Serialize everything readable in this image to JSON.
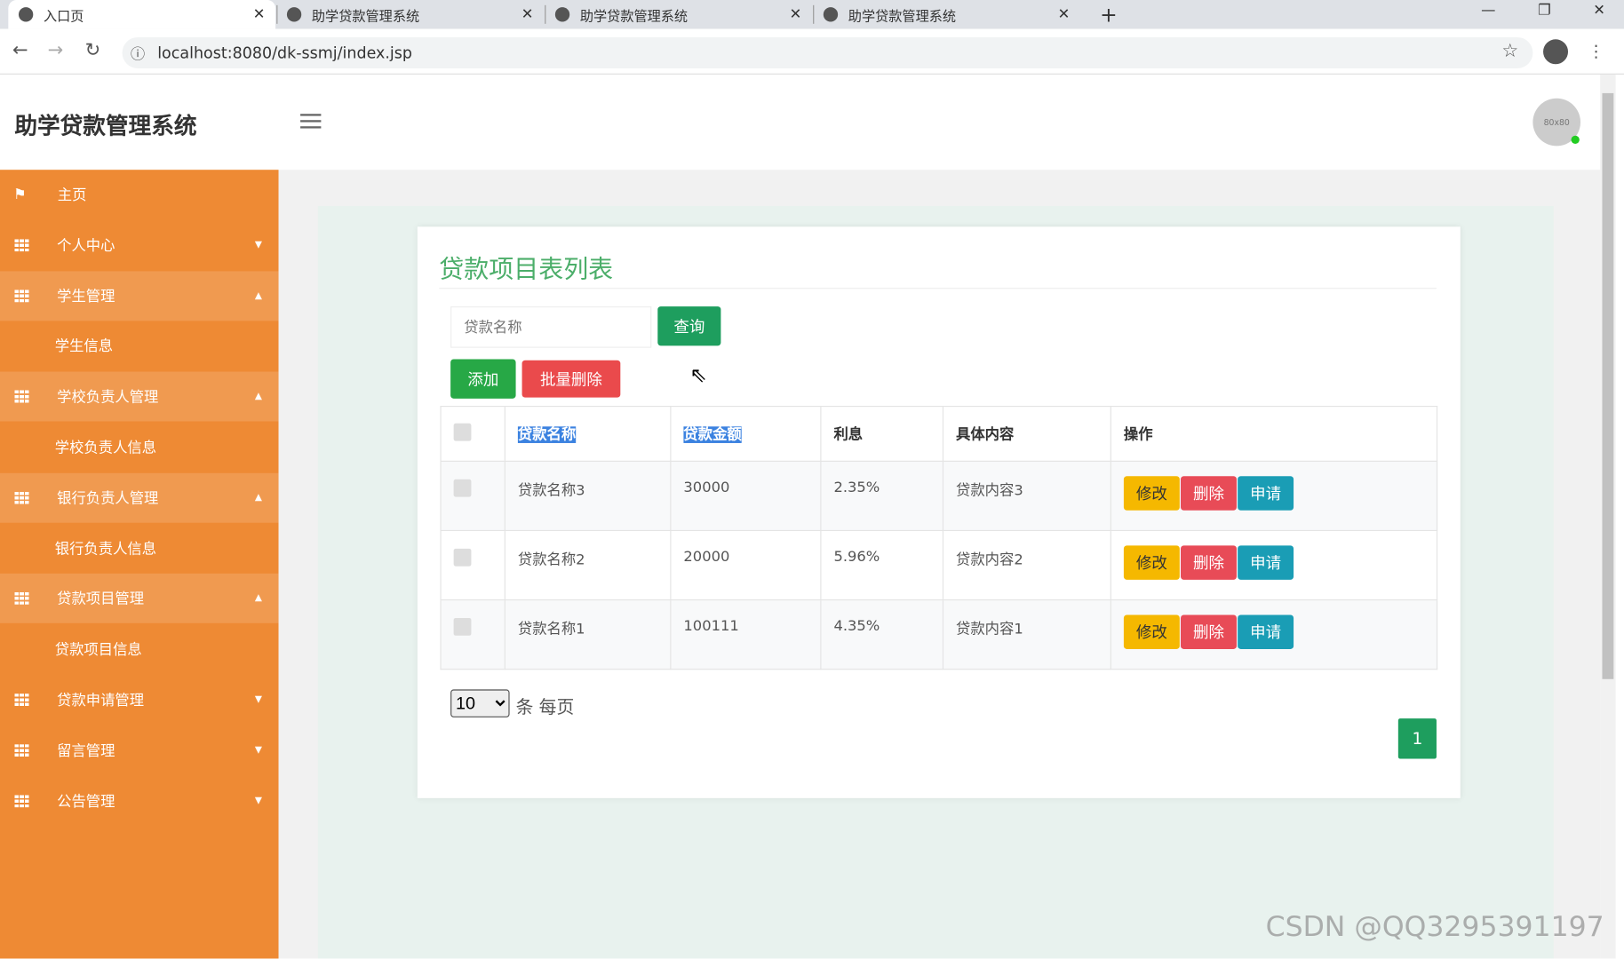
{
  "browser": {
    "tabs": [
      {
        "title": "入口页",
        "active": true
      },
      {
        "title": "助学贷款管理系统"
      },
      {
        "title": "助学贷款管理系统"
      },
      {
        "title": "助学贷款管理系统"
      }
    ],
    "new_tab": "+",
    "url": "localhost:8080/dk-ssmj/index.jsp"
  },
  "header": {
    "title": "助学贷款管理系统",
    "avatar_text": "80x80"
  },
  "sidebar": {
    "items": [
      {
        "label": "主页",
        "icon": "flag-icon"
      },
      {
        "label": "个人中心",
        "icon": "grid-icon",
        "arrow": "▼"
      },
      {
        "label": "学生管理",
        "icon": "grid-icon",
        "arrow": "▲",
        "open": true
      },
      {
        "label": "学生信息",
        "sub": true
      },
      {
        "label": "学校负责人管理",
        "icon": "grid-icon",
        "arrow": "▲",
        "open": true
      },
      {
        "label": "学校负责人信息",
        "sub": true
      },
      {
        "label": "银行负责人管理",
        "icon": "grid-icon",
        "arrow": "▲",
        "open": true
      },
      {
        "label": "银行负责人信息",
        "sub": true
      },
      {
        "label": "贷款项目管理",
        "icon": "grid-icon",
        "arrow": "▲",
        "open": true
      },
      {
        "label": "贷款项目信息",
        "sub": true
      },
      {
        "label": "贷款申请管理",
        "icon": "grid-icon",
        "arrow": "▼"
      },
      {
        "label": "留言管理",
        "icon": "grid-icon",
        "arrow": "▼"
      },
      {
        "label": "公告管理",
        "icon": "grid-icon",
        "arrow": "▼"
      }
    ]
  },
  "page": {
    "title": "贷款项目表列表",
    "search_placeholder": "贷款名称",
    "search_btn": "查询",
    "add_btn": "添加",
    "batch_delete_btn": "批量删除",
    "columns": [
      "贷款名称",
      "贷款金额",
      "利息",
      "具体内容",
      "操作"
    ],
    "rows": [
      {
        "name": "贷款名称3",
        "amount": "30000",
        "interest": "2.35%",
        "content": "贷款内容3"
      },
      {
        "name": "贷款名称2",
        "amount": "20000",
        "interest": "5.96%",
        "content": "贷款内容2"
      },
      {
        "name": "贷款名称1",
        "amount": "100111",
        "interest": "4.35%",
        "content": "贷款内容1"
      }
    ],
    "actions": {
      "edit": "修改",
      "delete": "删除",
      "apply": "申请"
    },
    "page_size": "10",
    "page_size_suffix": "条 每页",
    "current_page": "1"
  },
  "colors": {
    "sidebar": "#ee8a34",
    "primary": "#1e9e5e",
    "danger": "#e84b4b",
    "warning": "#f5b800",
    "info": "#1a9db5"
  },
  "watermark": "CSDN @QQ3295391197"
}
